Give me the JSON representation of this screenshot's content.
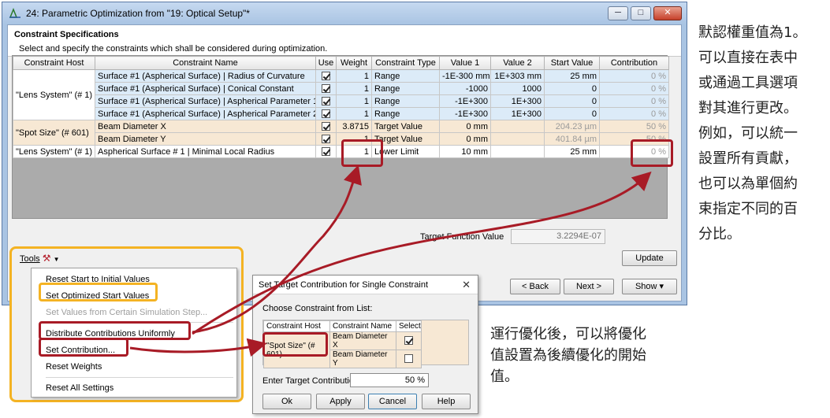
{
  "window": {
    "title": "24: Parametric Optimization from \"19: Optical Setup\"*",
    "controls": {
      "minimize": "─",
      "maximize": "□",
      "close": "✕"
    }
  },
  "header": {
    "title": "Constraint Specifications",
    "subtitle": "Select and specify the constraints which shall be considered during optimization."
  },
  "table": {
    "columns": [
      "Constraint Host",
      "Constraint Name",
      "Use",
      "Weight",
      "Constraint Type",
      "Value 1",
      "Value 2",
      "Start Value",
      "Contribution"
    ],
    "groups": [
      {
        "host": "\"Lens System\" (# 1)",
        "style": "blue",
        "rows": [
          {
            "name": "Surface #1 (Aspherical Surface) | Radius of Curvature",
            "use": true,
            "weight": "1",
            "type": "Range",
            "v1": "-1E-300 mm",
            "v2": "1E+303 mm",
            "start": "25 mm",
            "contrib": "0 %"
          },
          {
            "name": "Surface #1 (Aspherical Surface) | Conical Constant",
            "use": true,
            "weight": "1",
            "type": "Range",
            "v1": "-1000",
            "v2": "1000",
            "start": "0",
            "contrib": "0 %"
          },
          {
            "name": "Surface #1 (Aspherical Surface) | Aspherical Parameter 1",
            "use": true,
            "weight": "1",
            "type": "Range",
            "v1": "-1E+300",
            "v2": "1E+300",
            "start": "0",
            "contrib": "0 %"
          },
          {
            "name": "Surface #1 (Aspherical Surface) | Aspherical Parameter 2",
            "use": true,
            "weight": "1",
            "type": "Range",
            "v1": "-1E+300",
            "v2": "1E+300",
            "start": "0",
            "contrib": "0 %"
          }
        ]
      },
      {
        "host": "\"Spot Size\" (# 601)",
        "style": "tan",
        "rows": [
          {
            "name": "Beam Diameter X",
            "use": true,
            "weight": "3.8715",
            "type": "Target Value",
            "v1": "0 mm",
            "v2": "",
            "start": "204.23 µm",
            "contrib": "50 %"
          },
          {
            "name": "Beam Diameter Y",
            "use": true,
            "weight": "1",
            "type": "Target Value",
            "v1": "0 mm",
            "v2": "",
            "start": "401.84 µm",
            "contrib": "50 %"
          }
        ]
      },
      {
        "host": "\"Lens System\" (# 1)",
        "style": "white",
        "rows": [
          {
            "name": "Aspherical Surface # 1 | Minimal Local Radius",
            "use": true,
            "weight": "1",
            "type": "Lower Limit",
            "v1": "10 mm",
            "v2": "",
            "start": "25 mm",
            "contrib": "0 %"
          }
        ]
      }
    ]
  },
  "bottom": {
    "target_function_label": "Target Function Value",
    "target_function_value": "3.2294E-07",
    "update": "Update",
    "back": "< Back",
    "next": "Next >",
    "show": "Show ▾"
  },
  "tools_menu": {
    "button_label": "Tools",
    "items": [
      {
        "label": "Reset Start to Initial Values",
        "enabled": true
      },
      {
        "label": "Set Optimized Start Values",
        "enabled": true
      },
      {
        "label": "Set Values from Certain Simulation Step...",
        "enabled": false
      },
      {
        "label": "Distribute Contributions Uniformly",
        "enabled": true
      },
      {
        "label": "Set Contribution...",
        "enabled": true
      },
      {
        "label": "Reset Weights",
        "enabled": true
      },
      {
        "label": "Reset All Settings",
        "enabled": true
      }
    ]
  },
  "dialog": {
    "title": "Set Target Contribution for Single Constraint",
    "choose_label": "Choose Constraint from List:",
    "columns": [
      "Constraint Host",
      "Constraint Name",
      "Select"
    ],
    "host": "\"Spot Size\" (# 601)",
    "rows": [
      {
        "name": "Beam Diameter X",
        "select": true
      },
      {
        "name": "Beam Diameter Y",
        "select": false
      }
    ],
    "target_label": "Enter Target Contribution:",
    "target_value": "50 %",
    "ok": "Ok",
    "apply": "Apply",
    "cancel": "Cancel",
    "help": "Help"
  },
  "annotations": {
    "right_lines": [
      "默認權重值為1。",
      "可以直接在表中",
      "或通過工具選項",
      "對其進行更改。",
      "例如，可以統一",
      "設置所有貢獻，",
      "也可以為單個約",
      "束指定不同的百",
      "分比。"
    ],
    "bottom_lines": [
      "運行優化後，可以將優化",
      "值設置為後續優化的開始",
      "值。"
    ]
  },
  "colors": {
    "highlight_red": "#a81b26",
    "highlight_orange": "#f4b323",
    "row_blue": "#dcebf8",
    "row_tan": "#f7e8d4"
  }
}
